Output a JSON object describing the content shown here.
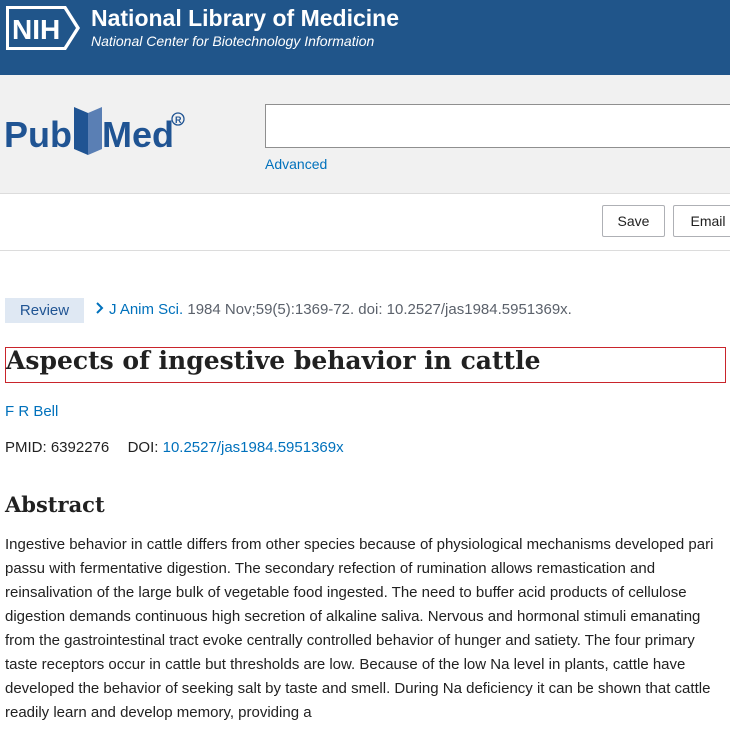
{
  "nih": {
    "logo_text": "NIH",
    "title": "National Library of Medicine",
    "subtitle": "National Center for Biotechnology Information"
  },
  "pubmed": {
    "logo_text": "PubMed",
    "search_value": "",
    "advanced_label": "Advanced"
  },
  "actions": {
    "save_label": "Save",
    "email_label": "Email"
  },
  "article": {
    "type_badge": "Review",
    "journal": "J Anim Sci.",
    "citation": "1984 Nov;59(5):1369-72. doi: 10.2527/jas1984.5951369x.",
    "title": "Aspects of ingestive behavior in cattle",
    "author": "F R Bell",
    "pmid_label": "PMID:",
    "pmid": "6392276",
    "doi_label": "DOI:",
    "doi": "10.2527/jas1984.5951369x"
  },
  "abstract": {
    "heading": "Abstract",
    "text": "Ingestive behavior in cattle differs from other species because of physiological mechanisms developed pari passu with fermentative digestion. The secondary refection of rumination allows remastication and reinsalivation of the large bulk of vegetable food ingested. The need to buffer acid products of cellulose digestion demands continuous high secretion of alkaline saliva. Nervous and hormonal stimuli emanating from the gastrointestinal tract evoke centrally controlled behavior of hunger and satiety. The four primary taste receptors occur in cattle but thresholds are low. Because of the low Na level in plants, cattle have developed the behavior of seeking salt by taste and smell. During Na deficiency it can be shown that cattle readily learn and develop memory, providing a"
  },
  "colors": {
    "nih_blue": "#20558a",
    "link_blue": "#0071bc",
    "pubmed_navy": "#205493",
    "title_outline": "#c9242b"
  }
}
